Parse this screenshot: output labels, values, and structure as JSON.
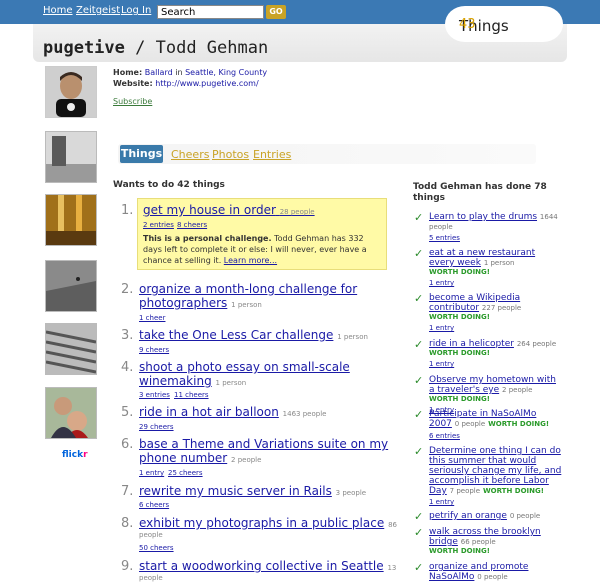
{
  "nav": {
    "home": "Home",
    "zeitgeist": "Zeitgeist",
    "login": "Log In",
    "search_value": "Search",
    "go": "GO"
  },
  "logo": {
    "num": "43",
    "word": "Things"
  },
  "title": {
    "user": "pugetive",
    "sep": " / ",
    "name": "Todd Gehman"
  },
  "profile": {
    "home_label": "Home:",
    "home_city": "Ballard",
    "home_in": "in",
    "home_region": "Seattle, King County",
    "website_label": "Website:",
    "website": "http://www.pugetive.com/",
    "subscribe": "Subscribe"
  },
  "flickr": {
    "a": "flick",
    "b": "r"
  },
  "tabs": {
    "things": "Things",
    "cheers": "Cheers",
    "photos": "Photos",
    "entries": "Entries"
  },
  "wants": {
    "heading": "Wants to do 42 things",
    "challenge_bold": "This is a personal challenge.",
    "challenge_text": " Todd Gehman has 332 days left to complete it or else: I will never, ever have a chance at selling it.",
    "learn_more": "Learn more...",
    "items": [
      {
        "n": "1.",
        "t": "get my house in order",
        "c": "28 people",
        "a": "2 entries",
        "b": "8 cheers"
      },
      {
        "n": "2.",
        "t1": "organize a month-long challenge for",
        "t2": "photographers",
        "c": "1 person",
        "a": "1 cheer"
      },
      {
        "n": "3.",
        "t": "take the One Less Car challenge",
        "c": "1 person",
        "a": "9 cheers"
      },
      {
        "n": "4.",
        "t1": "shoot a photo essay on small-scale",
        "t2": "winemaking",
        "c": "1 person",
        "a": "3 entries",
        "b": "11 cheers"
      },
      {
        "n": "5.",
        "t": "ride in a hot air balloon",
        "c": "1463 people",
        "a": "29 cheers"
      },
      {
        "n": "6.",
        "t1": "base a Theme and Variations suite on my",
        "t2": "phone number",
        "c": "2 people",
        "a": "1 entry",
        "b": "25 cheers"
      },
      {
        "n": "7.",
        "t": "rewrite my music server in Rails",
        "c": "3 people",
        "a": "6 cheers"
      },
      {
        "n": "8.",
        "t": "exhibit my photographs in a public place",
        "c": "86",
        "c2": "people",
        "a": "50 cheers"
      },
      {
        "n": "9.",
        "t": "start a woodworking collective in Seattle",
        "c": "13",
        "c2": "people"
      }
    ]
  },
  "done": {
    "heading": "Todd Gehman has done 78 things",
    "worth": "WORTH DOING!",
    "items": [
      {
        "t": "Learn to play the drums",
        "c": "1644 people",
        "l": "5 entries"
      },
      {
        "t1": "eat at a new restaurant",
        "t2": "every week",
        "c": "1 person",
        "l": "1 entry"
      },
      {
        "t1": "become a Wikipedia",
        "t2": "contributor",
        "c": "227 people",
        "l": "1 entry"
      },
      {
        "t": "ride in a helicopter",
        "c": "264 people",
        "l": "1 entry"
      },
      {
        "t1": "Observe my hometown with",
        "t2": "a traveler's eye",
        "c": "2 people",
        "l": "1 entry"
      },
      {
        "t1": "Participate in NaSoAlMo",
        "t2": "2007",
        "c": "0 people",
        "l": "6 entries"
      },
      {
        "t1": "Determine one thing I can do",
        "t2": "this summer that would",
        "t3": "seriously change my life, and",
        "t4": "accomplish it before Labor",
        "t5": "Day",
        "c": "7 people",
        "l": "1 entry"
      },
      {
        "t": "petrify an orange",
        "c": "0 people"
      },
      {
        "t1": "walk across the brooklyn",
        "t2": "bridge",
        "c": "66 people"
      },
      {
        "t1": "organize and promote",
        "t2": "NaSoAlMo",
        "c": "0 people"
      }
    ]
  }
}
